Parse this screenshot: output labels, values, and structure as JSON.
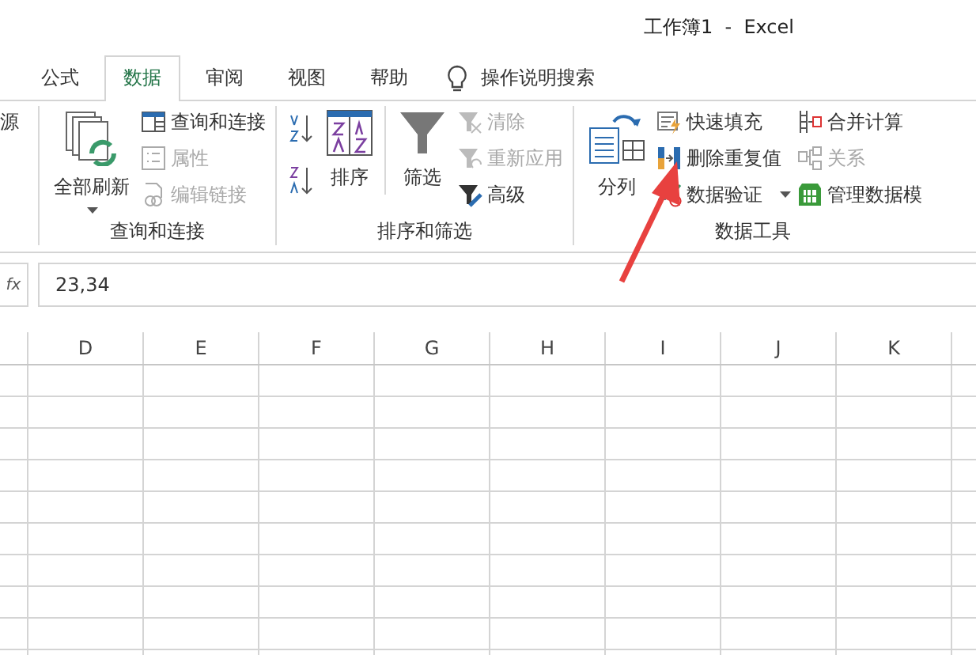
{
  "window": {
    "title": "工作簿1  -  Excel"
  },
  "tabs": [
    {
      "label": "公式",
      "selected": false
    },
    {
      "label": "数据",
      "selected": true
    },
    {
      "label": "审阅",
      "selected": false
    },
    {
      "label": "视图",
      "selected": false
    },
    {
      "label": "帮助",
      "selected": false
    }
  ],
  "tell_me": {
    "label": "操作说明搜索"
  },
  "ribbon_groups": [
    {
      "columns": [
        [
          {
            "kind": "small",
            "label": "源",
            "disabled": false
          }
        ]
      ]
    },
    {
      "label": "查询和连接",
      "columns": [
        [
          {
            "kind": "large",
            "label": "全部刷新",
            "disabled": false,
            "dropdown": true
          }
        ],
        [
          {
            "kind": "small",
            "label": "查询和连接",
            "disabled": false
          },
          {
            "kind": "small",
            "label": "属性",
            "disabled": true
          },
          {
            "kind": "small",
            "label": "编辑链接",
            "disabled": true
          }
        ]
      ]
    },
    {
      "label": "排序和筛选",
      "columns": [
        [
          {
            "kind": "sort"
          },
          {
            "kind": "sort"
          }
        ],
        [
          {
            "kind": "large",
            "label": "排序",
            "disabled": false
          }
        ],
        [
          {
            "kind": "large",
            "label": "筛选",
            "disabled": false
          }
        ],
        [
          {
            "kind": "small",
            "label": "清除",
            "disabled": true
          },
          {
            "kind": "small",
            "label": "重新应用",
            "disabled": true
          },
          {
            "kind": "small",
            "label": "高级",
            "disabled": false
          }
        ]
      ]
    },
    {
      "label": "数据工具",
      "columns": [
        [
          {
            "kind": "large",
            "label": "分列",
            "disabled": false
          }
        ],
        [
          {
            "kind": "small",
            "label": "快速填充",
            "disabled": false
          },
          {
            "kind": "small",
            "label": "删除重复值",
            "disabled": false
          },
          {
            "kind": "small",
            "label": "数据验证",
            "disabled": false,
            "dropdown": true
          }
        ],
        [
          {
            "kind": "small",
            "label": "合并计算",
            "disabled": false
          },
          {
            "kind": "small",
            "label": "关系",
            "disabled": true
          },
          {
            "kind": "small",
            "label": "管理数据模",
            "disabled": false
          }
        ]
      ]
    }
  ],
  "formula_bar": {
    "fx": "fx",
    "value": "23,34"
  },
  "columns": [
    "D",
    "E",
    "F",
    "G",
    "H",
    "I",
    "J",
    "K"
  ]
}
